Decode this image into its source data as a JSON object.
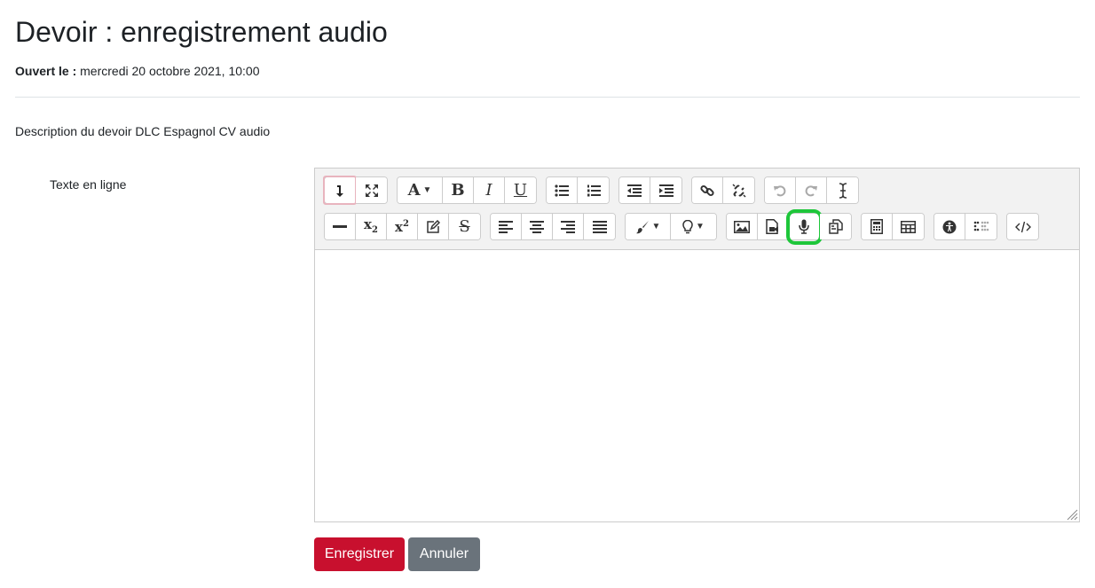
{
  "page": {
    "title": "Devoir : enregistrement audio",
    "dates": {
      "label": "Ouvert le :",
      "value": "mercredi 20 octobre 2021, 10:00"
    },
    "description": "Description du devoir DLC Espagnol CV audio"
  },
  "form": {
    "online_text_label": "Texte en ligne",
    "submit_label": "Enregistrer",
    "cancel_label": "Annuler",
    "editor_content": ""
  },
  "toolbar": {
    "row1": [
      {
        "group": [
          "toolbar-toggle-icon",
          "fullscreen-icon"
        ]
      },
      {
        "group": [
          "font-size-icon",
          "bold-icon",
          "italic-icon",
          "underline-icon"
        ]
      },
      {
        "group": [
          "unordered-list-icon",
          "ordered-list-icon"
        ]
      },
      {
        "group": [
          "outdent-icon",
          "indent-icon"
        ]
      },
      {
        "group": [
          "link-icon",
          "unlink-icon"
        ]
      },
      {
        "group": [
          "undo-icon",
          "redo-icon",
          "clear-formatting-icon"
        ]
      }
    ],
    "row2": [
      {
        "group": [
          "horizontal-rule-icon",
          "subscript-icon",
          "superscript-icon",
          "edit-html-icon",
          "strikethrough-icon"
        ]
      },
      {
        "group": [
          "align-left-icon",
          "align-center-icon",
          "align-right-icon",
          "justify-icon"
        ]
      },
      {
        "group": [
          "text-color-icon",
          "highlight-icon"
        ]
      },
      {
        "group": [
          "image-icon",
          "media-icon",
          "microphone-icon",
          "paste-icon"
        ]
      },
      {
        "group": [
          "calculator-icon",
          "table-icon"
        ]
      },
      {
        "group": [
          "accessibility-checker-icon",
          "screen-reader-helper-icon"
        ]
      },
      {
        "group": [
          "html-source-icon"
        ]
      }
    ],
    "highlighted_button": "microphone-icon",
    "highlight_color": "#1ec63a"
  },
  "colors": {
    "primary_button": "#c8102e",
    "secondary_button": "#6a737b"
  }
}
